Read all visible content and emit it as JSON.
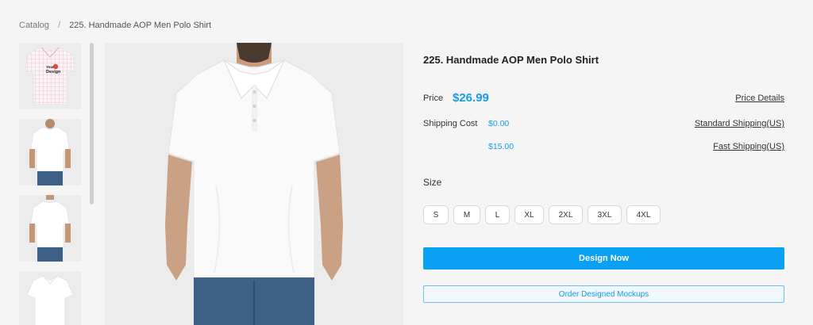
{
  "breadcrumb": {
    "root": "Catalog",
    "separator": "/",
    "current": "225. Handmade AOP Men Polo Shirt"
  },
  "product": {
    "title": "225. Handmade AOP Men Polo Shirt",
    "price_label": "Price",
    "price": "$26.99",
    "price_details_link": "Price Details",
    "shipping_label": "Shipping Cost",
    "shipping_options": [
      {
        "cost": "$0.00",
        "method": "Standard Shipping(US)"
      },
      {
        "cost": "$15.00",
        "method": "Fast Shipping(US)"
      }
    ]
  },
  "size": {
    "label": "Size",
    "options": [
      "S",
      "M",
      "L",
      "XL",
      "2XL",
      "3XL",
      "4XL"
    ]
  },
  "actions": {
    "design_now": "Design Now",
    "order_mockups": "Order Designed Mockups"
  },
  "thumbnails": [
    {
      "icon": "shirt-plaid-thumbnail",
      "badge_line1": "Your",
      "badge_line2": "Design"
    },
    {
      "icon": "shirt-front-thumbnail"
    },
    {
      "icon": "shirt-back-thumbnail"
    },
    {
      "icon": "shirt-flat-thumbnail"
    }
  ],
  "colors": {
    "accent": "#0aa0f5",
    "price": "#1a9be6",
    "background": "#f5f5f5"
  }
}
